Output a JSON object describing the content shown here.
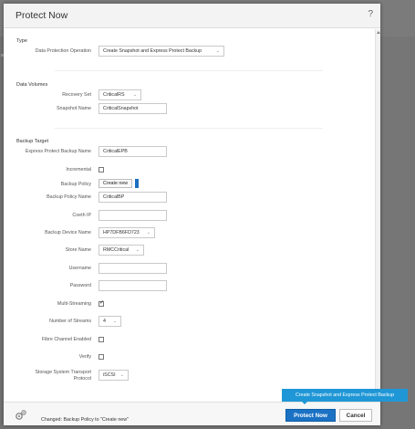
{
  "dialog": {
    "title": "Protect Now",
    "help": "?"
  },
  "sections": {
    "type": "Type",
    "data_volumes": "Data Volumes",
    "backup_target": "Backup Target"
  },
  "fields": {
    "data_protection_operation": {
      "label": "Data Protection Operation",
      "value": "Create Snapshot and Express Protect Backup"
    },
    "recovery_set": {
      "label": "Recovery Set",
      "value": "CriticalRS"
    },
    "snapshot_name": {
      "label": "Snapshot Name",
      "value": "CriticalSnapshot"
    },
    "express_protect_backup_name": {
      "label": "Express Protect Backup Name",
      "value": "CriticalEPB"
    },
    "incremental": {
      "label": "Incremental",
      "checked": false
    },
    "backup_policy": {
      "label": "Backup Policy",
      "button": "Create new"
    },
    "backup_policy_name": {
      "label": "Backup Policy Name",
      "value": "CriticalBP"
    },
    "coeth_ip": {
      "label": "Coeth IP",
      "value": ""
    },
    "backup_device_name": {
      "label": "Backup Device Name",
      "value": "HP7DFB6FD723"
    },
    "store_name": {
      "label": "Store Name",
      "value": "RMCCritical"
    },
    "username": {
      "label": "Username",
      "value": ""
    },
    "password": {
      "label": "Password",
      "value": ""
    },
    "multi_streaming": {
      "label": "Multi-Streaming",
      "checked": true
    },
    "number_of_streams": {
      "label": "Number of Streams",
      "value": "4"
    },
    "fibre_channel_enabled": {
      "label": "Fibre Channel Enabled",
      "checked": false
    },
    "verify": {
      "label": "Verify",
      "checked": false
    },
    "storage_system_transport_protocol": {
      "label_line1": "Storage System Transport",
      "label_line2": "Protocol",
      "value": "iSCSI"
    }
  },
  "footer": {
    "status": "Changed: Backup Policy to \"Create new\"",
    "protect_button": "Protect Now",
    "cancel_button": "Cancel",
    "tooltip": "Create Snapshot and Express Protect Backup"
  },
  "icons": {
    "gear": "settings-gear-icon",
    "chevron": "chevron-down-icon",
    "check": "checkmark-icon"
  },
  "colors": {
    "primary_button": "#1b72c4",
    "tooltip": "#1f97d6",
    "overlay": "#727272"
  }
}
